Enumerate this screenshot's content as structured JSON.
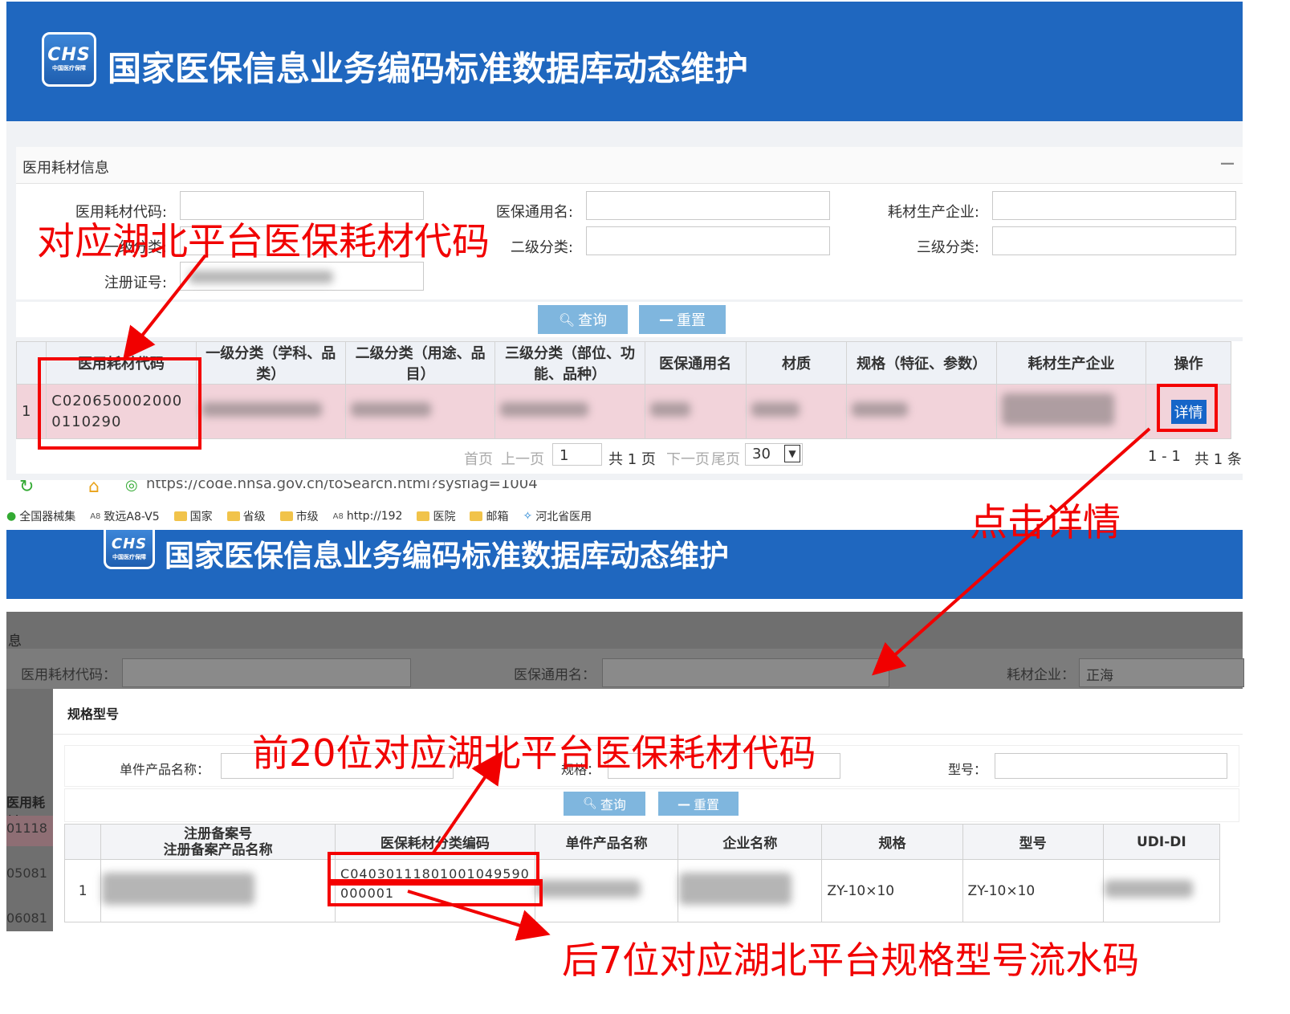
{
  "top": {
    "logo_big": "CHS",
    "logo_small": "中国医疗保障",
    "title": "国家医保信息业务编码标准数据库动态维护",
    "panel_title": "医用耗材信息",
    "collapse_symbol": "—",
    "form": {
      "code_label": "医用耗材代码:",
      "generic_label": "医保通用名:",
      "maker_label": "耗材生产企业:",
      "level1_label": "一级分类:",
      "level2_label": "二级分类:",
      "level3_label": "三级分类:",
      "reg_label": "注册证号:"
    },
    "query_btn": "查询",
    "reset_btn": "重置",
    "table": {
      "headers": [
        "",
        "医用耗材代码",
        "一级分类（学科、品类）",
        "二级分类（用途、品目）",
        "三级分类（部位、功能、品种）",
        "医保通用名",
        "材质",
        "规格（特征、参数）",
        "耗材生产企业",
        "操作"
      ],
      "row_index": "1",
      "row_code": "C0206500020000110290",
      "detail_btn": "详情"
    },
    "pager": {
      "first": "首页",
      "prev": "上一页",
      "page_value": "1",
      "total_pages": "共 1 页",
      "next": "下一页",
      "last": "尾页",
      "page_size": "30",
      "range": "1 - 1",
      "total": "共 1 条"
    }
  },
  "browser": {
    "url": "https://code.nhsa.gov.cn/toSearch.html?sysflag=1004",
    "bookmarks": [
      "全国器械集",
      "致远A8-V5",
      "国家",
      "省级",
      "市级",
      "http://192",
      "医院",
      "邮箱",
      "河北省医用"
    ]
  },
  "bottom": {
    "title": "国家医保信息业务编码标准数据库动态维护",
    "bg_labels": {
      "info": "息",
      "code": "医用耗材代码：",
      "generic": "医保通用名：",
      "maker": "耗材企业：",
      "maker_value": "正海",
      "left_head": "医用耗材",
      "row_codes": [
        "01118",
        "05081",
        "06081"
      ]
    },
    "modal": {
      "title": "规格型号",
      "product_label": "单件产品名称：",
      "spec_label": "规格：",
      "model_label": "型号：",
      "query_btn": "查询",
      "reset_btn": "重置",
      "headers": [
        "",
        "注册备案号\n注册备案产品名称",
        "医保耗材分类编码",
        "单件产品名称",
        "企业名称",
        "规格",
        "型号",
        "UDI-DI"
      ],
      "row_index": "1",
      "code_line1": "C04030111801001049590",
      "code_line2": "000001",
      "spec": "ZY-10×10",
      "model": "ZY-10×10"
    }
  },
  "annotations": {
    "a1": "对应湖北平台医保耗材代码",
    "a2": "点击详情",
    "a3": "前20位对应湖北平台医保耗材代码",
    "a4": "后7位对应湖北平台规格型号流水码"
  },
  "colors": {
    "header_blue": "#1f67bf",
    "button_blue": "#7fb6de",
    "row_pink": "#f2d3da",
    "annotation_red": "#f10000"
  }
}
